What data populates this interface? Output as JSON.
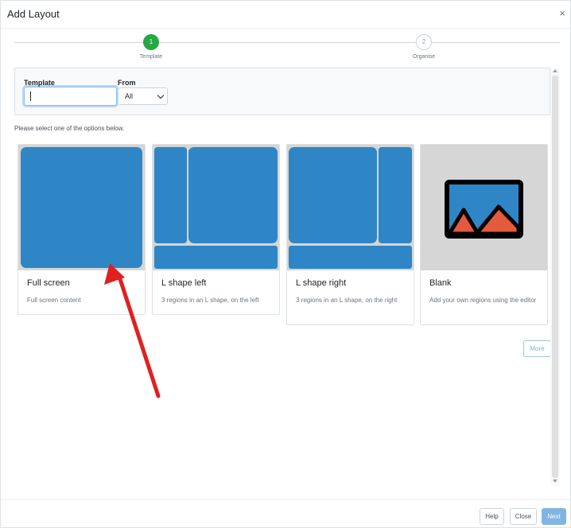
{
  "modal": {
    "title": "Add Layout",
    "close_glyph": "×"
  },
  "stepper": {
    "steps": [
      {
        "number": "1",
        "label": "Template",
        "state": "active",
        "color": "#28a745"
      },
      {
        "number": "2",
        "label": "Organise",
        "state": "inactive"
      }
    ]
  },
  "filters": {
    "template_label": "Template",
    "template_value": "",
    "from_label": "From",
    "from_selected": "All"
  },
  "instruction": "Please select one of the options below.",
  "cards": [
    {
      "title": "Full screen",
      "description": "Full screen content",
      "icon": "full-screen-layout-icon"
    },
    {
      "title": "L shape left",
      "description": "3 regions in an L shape, on the left",
      "icon": "l-shape-left-layout-icon"
    },
    {
      "title": "L shape right",
      "description": "3 regions in an L shape, on the right",
      "icon": "l-shape-right-layout-icon"
    },
    {
      "title": "Blank",
      "description": "Add your own regions using the editor",
      "icon": "image-placeholder-icon"
    }
  ],
  "more_label": "More",
  "footer": {
    "help_label": "Help",
    "close_label": "Close",
    "next_label": "Next"
  },
  "colors": {
    "region_blue": "#2f86c6",
    "annotation_red": "#e02020",
    "next_button": "#80b5e2"
  }
}
